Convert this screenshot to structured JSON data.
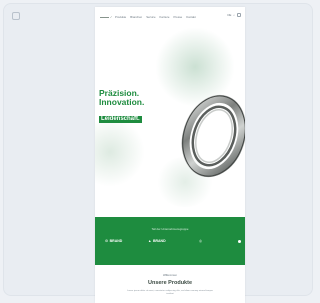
{
  "header": {
    "logo": "▬▬▬ ✓",
    "nav": [
      "Produkte",
      "Branchen",
      "Service",
      "Karriere",
      "Presse",
      "Kontakt"
    ],
    "language": "DE",
    "menu_icon": "menu-icon"
  },
  "hero": {
    "line1": "Präzision.",
    "line2": "Innovation.",
    "line3": "Leidenschaft."
  },
  "band": {
    "caption": "Teil der Unternehmensgruppe",
    "logos": [
      "BRAND",
      "BRAND",
      "BRAND"
    ]
  },
  "section": {
    "eyebrow": "Willkommen",
    "title": "Unsere Produkte",
    "text": "Lorem ipsum dolor sit amet, consetetur sadipscing elitr, sed diam nonumy eirmod tempor invidunt"
  },
  "colors": {
    "brand_green": "#1e8c3f",
    "background": "#eef1f5"
  }
}
